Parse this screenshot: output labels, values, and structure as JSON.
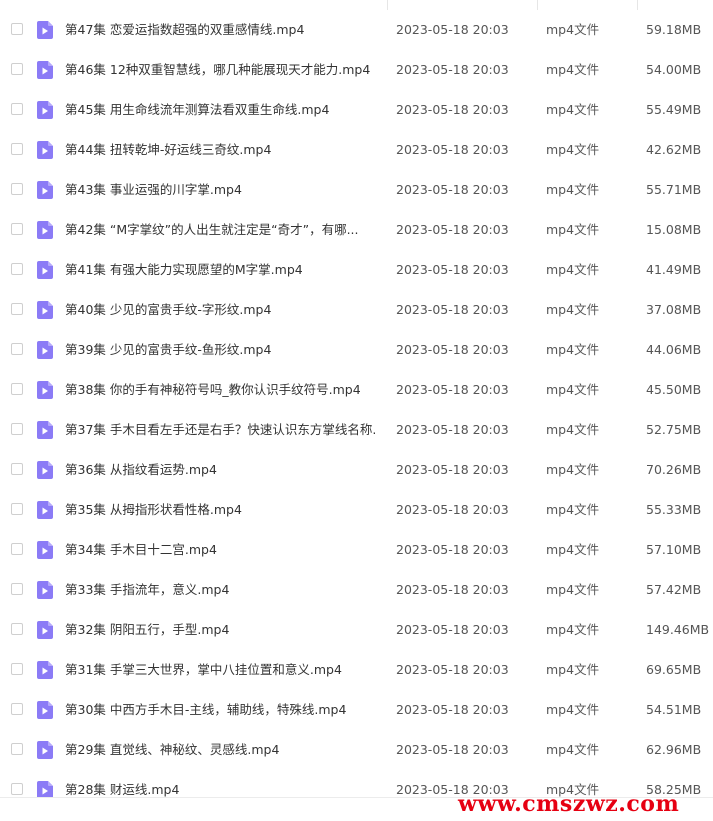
{
  "watermark": "www.cmszwz.com",
  "colors": {
    "icon_purple": "#8b7bf6",
    "watermark_red": "#e60012"
  },
  "file_list": {
    "icon": "video-file-icon",
    "rows": [
      {
        "name": "第47集 恋爱运指数超强的双重感情线.mp4",
        "date": "2023-05-18 20:03",
        "type": "mp4文件",
        "size": "59.18MB"
      },
      {
        "name": "第46集 12种双重智慧线，哪几种能展现天才能力.mp4",
        "date": "2023-05-18 20:03",
        "type": "mp4文件",
        "size": "54.00MB"
      },
      {
        "name": "第45集 用生命线流年测算法看双重生命线.mp4",
        "date": "2023-05-18 20:03",
        "type": "mp4文件",
        "size": "55.49MB"
      },
      {
        "name": "第44集 扭转乾坤-好运线三奇纹.mp4",
        "date": "2023-05-18 20:03",
        "type": "mp4文件",
        "size": "42.62MB"
      },
      {
        "name": "第43集 事业运强的川字掌.mp4",
        "date": "2023-05-18 20:03",
        "type": "mp4文件",
        "size": "55.71MB"
      },
      {
        "name": "第42集 “M字掌纹”的人出生就注定是“奇才”，有哪...",
        "date": "2023-05-18 20:03",
        "type": "mp4文件",
        "size": "15.08MB"
      },
      {
        "name": "第41集 有强大能力实现愿望的M字掌.mp4",
        "date": "2023-05-18 20:03",
        "type": "mp4文件",
        "size": "41.49MB"
      },
      {
        "name": "第40集 少见的富贵手纹-字形纹.mp4",
        "date": "2023-05-18 20:03",
        "type": "mp4文件",
        "size": "37.08MB"
      },
      {
        "name": "第39集 少见的富贵手纹-鱼形纹.mp4",
        "date": "2023-05-18 20:03",
        "type": "mp4文件",
        "size": "44.06MB"
      },
      {
        "name": "第38集 你的手有神秘符号吗_教你认识手纹符号.mp4",
        "date": "2023-05-18 20:03",
        "type": "mp4文件",
        "size": "45.50MB"
      },
      {
        "name": "第37集 手木目看左手还是右手？快速认识东方掌线名称....",
        "date": "2023-05-18 20:03",
        "type": "mp4文件",
        "size": "52.75MB"
      },
      {
        "name": "第36集 从指纹看运势.mp4",
        "date": "2023-05-18 20:03",
        "type": "mp4文件",
        "size": "70.26MB"
      },
      {
        "name": "第35集 从拇指形状看性格.mp4",
        "date": "2023-05-18 20:03",
        "type": "mp4文件",
        "size": "55.33MB"
      },
      {
        "name": "第34集 手木目十二宫.mp4",
        "date": "2023-05-18 20:03",
        "type": "mp4文件",
        "size": "57.10MB"
      },
      {
        "name": "第33集 手指流年，意义.mp4",
        "date": "2023-05-18 20:03",
        "type": "mp4文件",
        "size": "57.42MB"
      },
      {
        "name": "第32集 阴阳五行，手型.mp4",
        "date": "2023-05-18 20:03",
        "type": "mp4文件",
        "size": "149.46MB"
      },
      {
        "name": "第31集 手掌三大世界，掌中八挂位置和意义.mp4",
        "date": "2023-05-18 20:03",
        "type": "mp4文件",
        "size": "69.65MB"
      },
      {
        "name": "第30集 中西方手木目-主线，辅助线，特殊线.mp4",
        "date": "2023-05-18 20:03",
        "type": "mp4文件",
        "size": "54.51MB"
      },
      {
        "name": "第29集 直觉线、神秘纹、灵感线.mp4",
        "date": "2023-05-18 20:03",
        "type": "mp4文件",
        "size": "62.96MB"
      },
      {
        "name": "第28集 财运线.mp4",
        "date": "2023-05-18 20:03",
        "type": "mp4文件",
        "size": "58.25MB"
      }
    ]
  }
}
